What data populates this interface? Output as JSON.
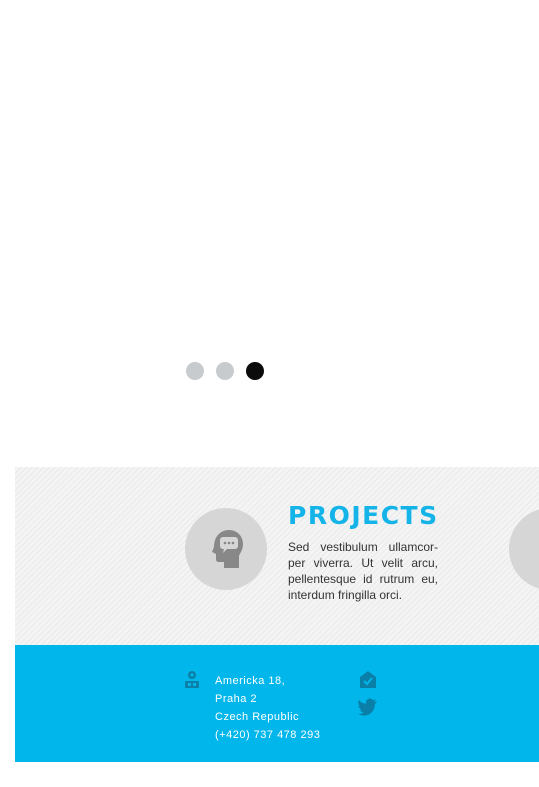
{
  "slider": {
    "dots": [
      {
        "label": "slide-1",
        "active": false
      },
      {
        "label": "slide-2",
        "active": false
      },
      {
        "label": "slide-3",
        "active": true
      }
    ]
  },
  "features": {
    "title": "PROJECTS",
    "text": "Sed vestibulum ullamcor-per viverra. Ut velit arcu, pellentesque id rutrum eu, interdum fringilla orci.",
    "icons": [
      "head-idea-icon",
      "pen-icon"
    ]
  },
  "footer": {
    "address_lines": [
      "Americka 18,",
      "Praha 2",
      "Czech Republic",
      "(+420) 737 478 293"
    ],
    "icons": [
      "location-icon",
      "mail-icon",
      "twitter-icon"
    ]
  },
  "colors": {
    "accent": "#15b4e8",
    "footer_bg": "#00b6ea",
    "dot_inactive": "#c8cbce",
    "dot_active": "#0b0b0b",
    "icon_circle": "#d6d6d6"
  }
}
